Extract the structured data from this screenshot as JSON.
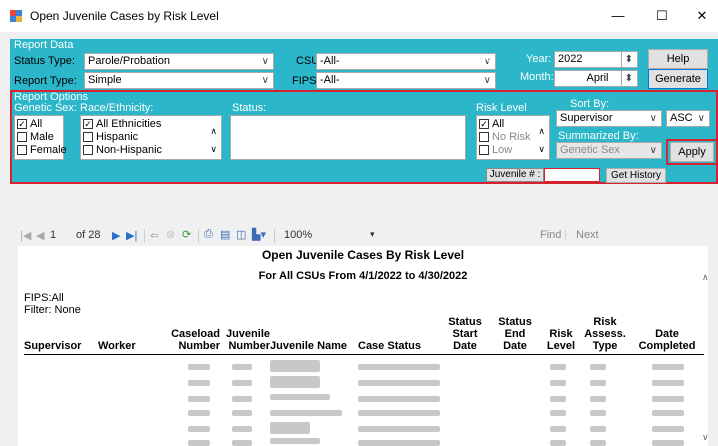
{
  "window": {
    "title": "Open Juvenile Cases by Risk Level",
    "minimize": "—",
    "maximize": "☐",
    "close": "✕"
  },
  "report_data": {
    "header": "Report Data",
    "status_type_label": "Status Type:",
    "status_type_value": "Parole/Probation",
    "report_type_label": "Report Type:",
    "report_type_value": "Simple",
    "csu_label": "CSU:",
    "csu_value": "-All-",
    "fips_label": "FIPS:",
    "fips_value": "-All-",
    "year_label": "Year:",
    "year_value": "2022",
    "month_label": "Month:",
    "month_value": "April",
    "help_button": "Help",
    "generate_button": "Generate"
  },
  "report_options": {
    "header": "Report Options",
    "genetic_sex_label": "Genetic Sex:",
    "genetic_sex": [
      {
        "label": "All",
        "checked": true
      },
      {
        "label": "Male",
        "checked": false
      },
      {
        "label": "Female",
        "checked": false
      }
    ],
    "race_label": "Race/Ethnicity:",
    "race": [
      {
        "label": "All Ethnicities",
        "checked": true
      },
      {
        "label": "Hispanic",
        "checked": false
      },
      {
        "label": "Non-Hispanic",
        "checked": false
      }
    ],
    "status_label": "Status:",
    "risk_label": "Risk Level",
    "risk": [
      {
        "label": "All",
        "checked": true
      },
      {
        "label": "No Risk",
        "checked": false
      },
      {
        "label": "Low",
        "checked": false
      }
    ],
    "sort_by_label": "Sort By:",
    "sort_by_value": "Supervisor",
    "sort_dir_value": "ASC",
    "summarized_by_label": "Summarized By:",
    "summarized_by_value": "Genetic Sex",
    "apply_button": "Apply",
    "juvenile_label": "Juvenile # :",
    "juvenile_value": "",
    "get_history_button": "Get History"
  },
  "toolbar": {
    "page_current": "1",
    "page_of": "of 28",
    "zoom": "100%",
    "find": "Find",
    "next": "Next"
  },
  "report": {
    "title": "Open Juvenile Cases By Risk Level",
    "subtitle": "For All CSUs From 4/1/2022 to 4/30/2022",
    "fips": "FIPS:All",
    "filter": "Filter: None",
    "col_supervisor": "Supervisor",
    "col_worker": "Worker",
    "col_caseload": "Caseload Number",
    "col_juvenile": "Juvenile Number",
    "col_name": "Juvenile Name",
    "col_case_status": "Case Status",
    "col_status_start": "Status Start Date",
    "col_status_end": "Status End Date",
    "col_risk_level": "Risk Level",
    "col_risk_assess": "Risk Assess. Type",
    "col_date_completed": "Date Completed"
  },
  "colors": {
    "panel": "#2bb7c9",
    "highlight": "#d6232f"
  }
}
